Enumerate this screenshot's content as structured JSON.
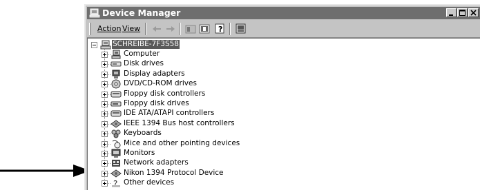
{
  "window": {
    "title": "Device Manager"
  },
  "title_buttons": [
    "minimize-icon",
    "maximize-icon",
    "close-icon"
  ],
  "menu": {
    "action": "Action",
    "view": "View"
  },
  "toolbar_icons": [
    "back-arrow-icon",
    "forward-arrow-icon",
    "tree-view-icon",
    "properties-icon",
    "help-icon",
    "scan-hardware-icon"
  ],
  "tree": {
    "root": "SCHREIBE-7F3S58",
    "items": [
      {
        "label": "Computer",
        "icon": "computer-icon"
      },
      {
        "label": "Disk drives",
        "icon": "disk-drive-icon"
      },
      {
        "label": "Display adapters",
        "icon": "display-adapter-icon"
      },
      {
        "label": "DVD/CD-ROM drives",
        "icon": "dvd-drive-icon"
      },
      {
        "label": "Floppy disk controllers",
        "icon": "floppy-controller-icon"
      },
      {
        "label": "Floppy disk drives",
        "icon": "floppy-drive-icon"
      },
      {
        "label": "IDE ATA/ATAPI controllers",
        "icon": "ide-controller-icon"
      },
      {
        "label": "IEEE 1394 Bus host controllers",
        "icon": "ieee1394-icon"
      },
      {
        "label": "Keyboards",
        "icon": "keyboard-icon"
      },
      {
        "label": "Mice and other pointing devices",
        "icon": "mouse-icon"
      },
      {
        "label": "Monitors",
        "icon": "monitor-icon"
      },
      {
        "label": "Network adapters",
        "icon": "network-adapter-icon"
      },
      {
        "label": "Nikon 1394 Protocol Device",
        "icon": "nikon-device-icon"
      },
      {
        "label": "Other devices",
        "icon": "unknown-device-icon"
      }
    ]
  },
  "colors": {
    "titlebar": "#6e6e6e",
    "root_highlight": "#5a5a5a",
    "window_bg": "#c4c4c4"
  }
}
